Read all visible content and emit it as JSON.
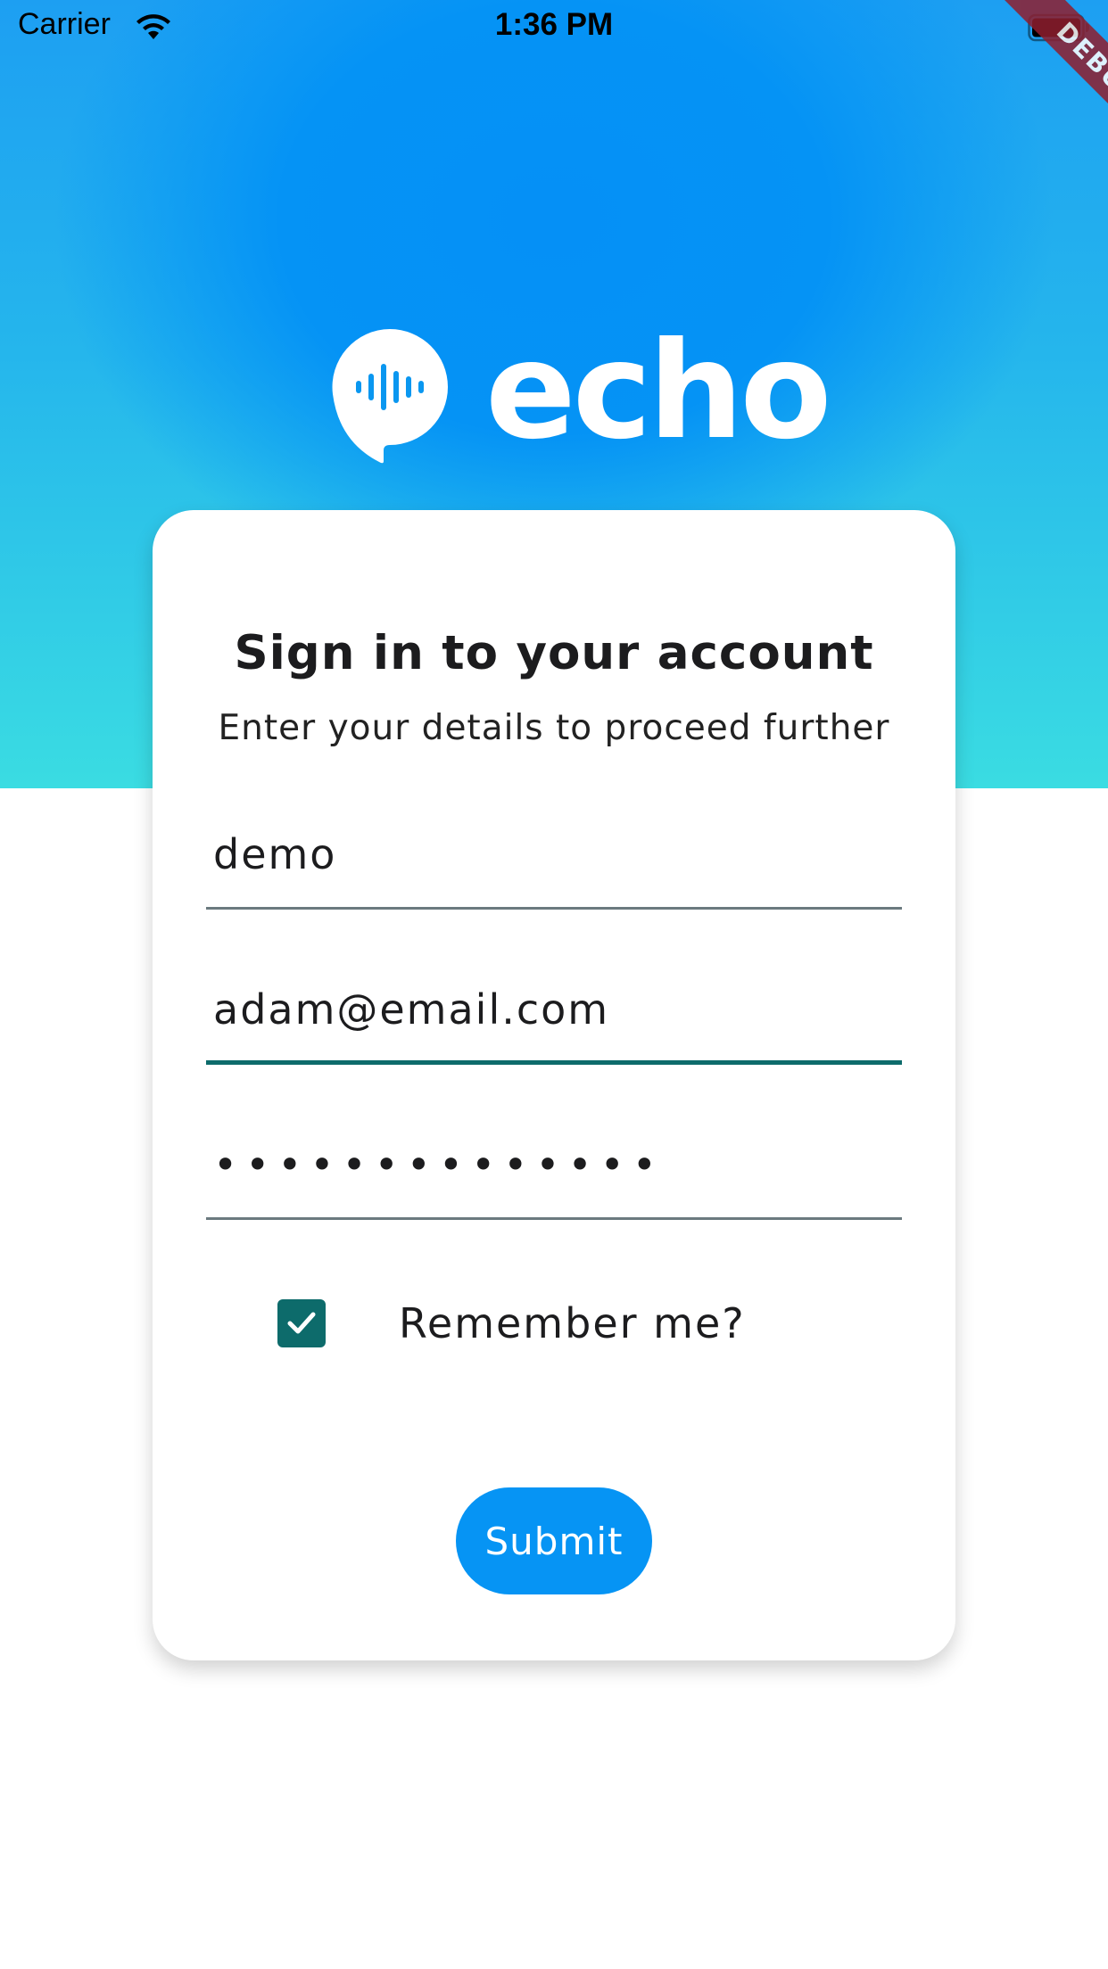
{
  "status_bar": {
    "carrier": "Carrier",
    "time": "1:36 PM",
    "wifi_icon": "wifi-icon",
    "battery_icon": "battery-full-icon"
  },
  "debug_banner": "DEBUG",
  "brand": {
    "name": "echo",
    "logo_icon": "chat-bubble-soundwave-icon"
  },
  "card": {
    "title": "Sign in to your account",
    "subtitle": "Enter your details to proceed further",
    "fields": {
      "username": {
        "value": "demo"
      },
      "email": {
        "value": "adam@email.com"
      },
      "password": {
        "value": "••••••••••••••",
        "icon": "password-masked"
      }
    },
    "remember": {
      "label": "Remember me?",
      "checked": true,
      "icon": "check-icon"
    },
    "submit_label": "Submit"
  },
  "colors": {
    "primary_blue": "#0694f4",
    "gradient_top": "#0593f5",
    "gradient_bottom": "#3adce2",
    "accent_teal": "#0d6b6b",
    "debug_red": "#8f1e2e"
  }
}
